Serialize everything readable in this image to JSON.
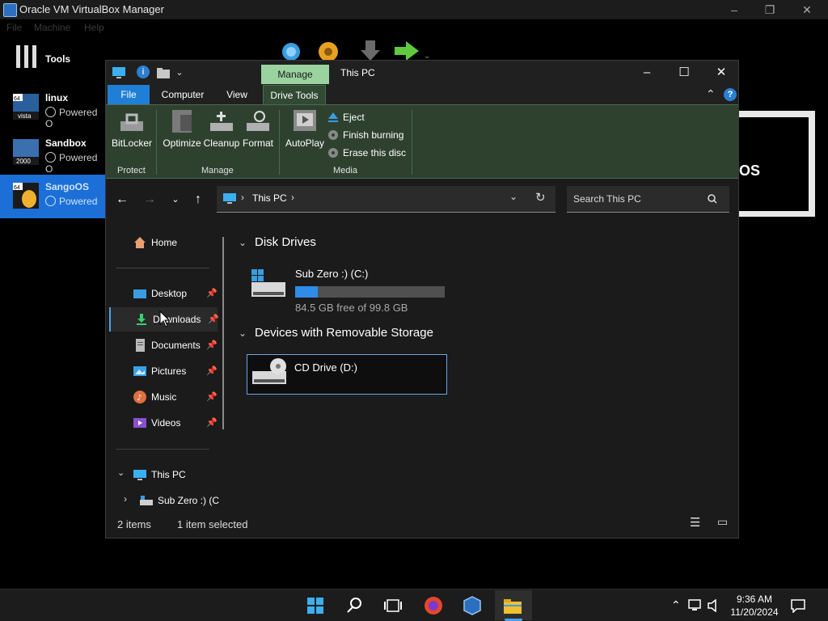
{
  "vbox": {
    "title": "Oracle VM VirtualBox Manager",
    "menu": [
      "File",
      "Machine",
      "Help"
    ],
    "tools_label": "Tools",
    "vms": [
      {
        "name": "linux",
        "status": "Powered O",
        "badge": "64 vista"
      },
      {
        "name": "Sandbox",
        "status": "Powered O",
        "badge": "2000"
      },
      {
        "name": "SangoOS",
        "status": "Powered",
        "badge": "64"
      }
    ],
    "preview_text": "OS"
  },
  "explorer": {
    "context_tab": "Manage",
    "window_title": "This PC",
    "ribbon_tabs": [
      "File",
      "Computer",
      "View",
      "Drive Tools"
    ],
    "ribbon": {
      "buttons": [
        "BitLocker",
        "Optimize",
        "Cleanup",
        "Format",
        "AutoPlay"
      ],
      "small_commands": [
        "Eject",
        "Finish burning",
        "Erase this disc"
      ],
      "groups": [
        "Protect",
        "Manage",
        "Media"
      ]
    },
    "address": "This PC",
    "search_placeholder": "Search This PC",
    "nav": {
      "home": "Home",
      "quick": [
        "Desktop",
        "Downloads",
        "Documents",
        "Pictures",
        "Music",
        "Videos"
      ],
      "this_pc": "This PC",
      "sub_drive": "Sub Zero :) (C"
    },
    "groups": {
      "disk_drives": "Disk Drives",
      "removable": "Devices with Removable Storage"
    },
    "drives": {
      "c": {
        "name": "Sub Zero :) (C:)",
        "free_text": "84.5 GB free of 99.8 GB",
        "used_fraction": 0.153
      },
      "d": {
        "name": "CD Drive (D:)"
      }
    },
    "status": {
      "items": "2 items",
      "selected": "1 item selected"
    }
  },
  "taskbar": {
    "time": "9:36 AM",
    "date": "11/20/2024"
  },
  "colors": {
    "accent": "#1f7fd6",
    "ribbon_green": "#2e412f",
    "manage_tab": "#9bd3a0",
    "drive_fill": "#2f8ce8"
  }
}
